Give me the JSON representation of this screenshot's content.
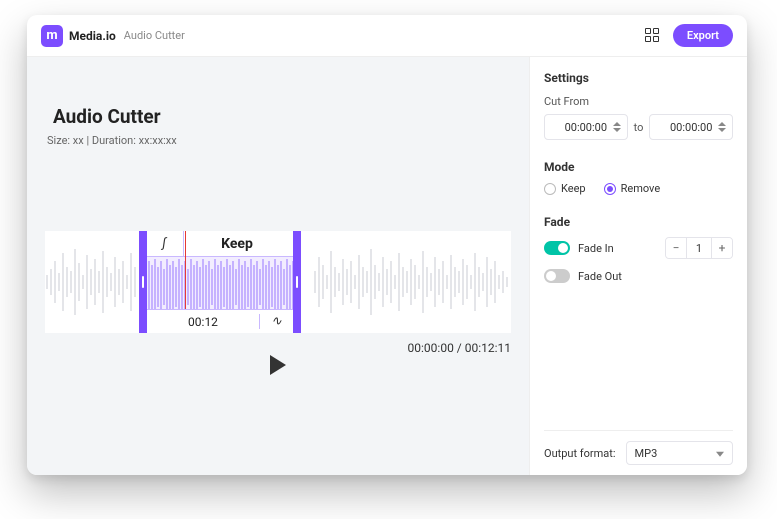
{
  "header": {
    "brand": "Media.io",
    "breadcrumb": "Audio Cutter",
    "export_label": "Export"
  },
  "main": {
    "title": "Audio Cutter",
    "meta": "Size: xx | Duration: xx:xx:xx",
    "selection_label": "Keep",
    "selection_time": "00:12",
    "time_readout": "00:00:00 / 00:12:11"
  },
  "sidebar": {
    "settings_title": "Settings",
    "cut_from_label": "Cut From",
    "cut_from_value": "00:00:00",
    "to_label": "to",
    "cut_to_value": "00:00:00",
    "mode_title": "Mode",
    "mode_keep_label": "Keep",
    "mode_remove_label": "Remove",
    "mode_selected": "Remove",
    "fade_title": "Fade",
    "fade_in_label": "Fade In",
    "fade_in_on": true,
    "fade_in_value": "1",
    "fade_out_label": "Fade Out",
    "fade_out_on": false,
    "output_label": "Output format:",
    "output_value": "MP3"
  },
  "colors": {
    "accent": "#7c4dff",
    "teal": "#00c4a7"
  }
}
